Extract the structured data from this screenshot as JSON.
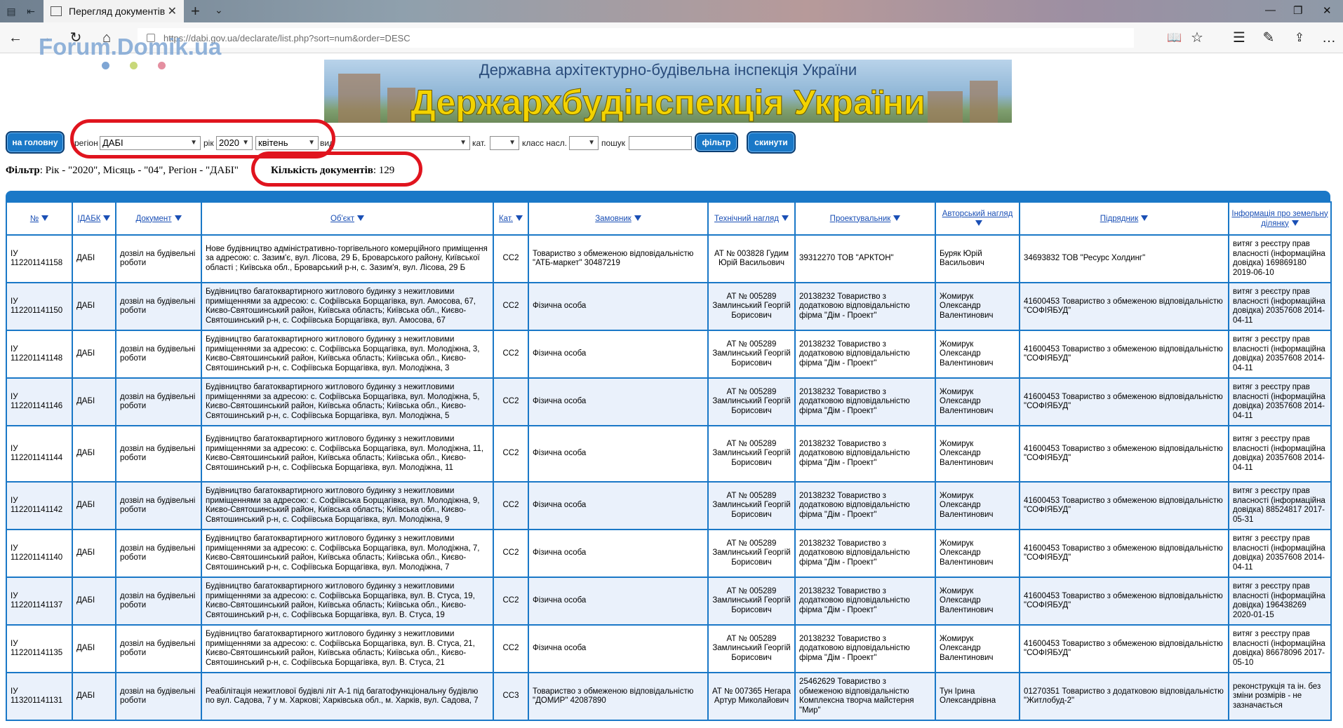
{
  "browser": {
    "tab_title": "Перегляд документів",
    "url": "https://dabi.gov.ua/declarate/list.php?sort=num&order=DESC"
  },
  "watermark": {
    "text": "Forum.Domik.ua",
    "dot_colors": [
      "#7fa6d4",
      "#c8d87a",
      "#e48fa0"
    ]
  },
  "banner": {
    "subtitle": "Державна архітектурно-будівельна інспекція України",
    "title": "Держархбудінспекція України"
  },
  "filters": {
    "home_button": "на головну",
    "region_label": "регіон",
    "region_value": "ДАБІ",
    "year_label": "рік",
    "year_value": "2020",
    "month_value": "квітень",
    "type_label": "вид",
    "type_value": "",
    "cat_label": "кат.",
    "cat_value": "",
    "class_label": "класс насл.",
    "class_value": "",
    "search_label": "пошук",
    "search_value": "",
    "filter_button": "фільтр",
    "reset_button": "скинути"
  },
  "summary": {
    "filter_label": "Фільтр",
    "filter_text": ": Рік - \"2020\", Місяць - \"04\", Регіон - \"ДАБІ\"",
    "count_label": "Кількість документів",
    "count_value": ": 129"
  },
  "table": {
    "headers": [
      "№",
      "ІДАБК",
      "Документ",
      "Об'єкт",
      "Кат.",
      "Замовник",
      "Технічний нагляд",
      "Проектувальник",
      "Авторський нагляд",
      "Підрядник",
      "Інформація про земельну ділянку"
    ],
    "rows": [
      {
        "num": "ІУ 112201141158",
        "idabk": "ДАБІ",
        "doc": "дозвіл на будівельні роботи",
        "object": "Нове будівництво адміністративно-торгівельного комерційного приміщення за адресою: с. Зазим'є, вул. Лісова, 29 Б, Броварського району, Київської області ; Київська обл., Броварський р-н, с. Зазим'я, вул. Лісова, 29 Б",
        "cat": "СС2",
        "customer": "Товариство з обмеженою відповідальністю \"АТБ-маркет\" 30487219",
        "tech": "АТ № 003828 Гудим Юрій Васильович",
        "designer": "39312270 ТОВ \"АРКТОН\"",
        "author": "Буряк Юрій Васильович",
        "contractor": "34693832 ТОВ \"Ресурс Холдинг\"",
        "land": "витяг з реєстру прав власності (інформаційна довідка) 169869180 2019-06-10"
      },
      {
        "num": "ІУ 112201141150",
        "idabk": "ДАБІ",
        "doc": "дозвіл на будівельні роботи",
        "object": "Будівництво багатоквартирного житлового будинку з нежитловими приміщеннями за адресою: с. Софіївська Борщагівка, вул. Амосова, 67, Києво-Святошинський район, Київська область; Київська обл., Києво-Святошинський р-н, с. Софіївська Борщагівка, вул. Амосова, 67",
        "cat": "СС2",
        "customer": "Фізична особа",
        "tech": "АТ № 005289 Замлинський Георгій Борисович",
        "designer": "20138232 Товариство з додатковою відповідальністю фірма \"Дім - Проект\"",
        "author": "Жомирук Олександр Валентинович",
        "contractor": "41600453 Товариство з обмеженою відповідальністю \"СОФІЯБУД\"",
        "land": "витяг з реєстру прав власності (інформаційна довідка) 20357608 2014-04-11"
      },
      {
        "num": "ІУ 112201141148",
        "idabk": "ДАБІ",
        "doc": "дозвіл на будівельні роботи",
        "object": "Будівництво багатоквартирного житлового будинку з нежитловими приміщеннями за адресою: с. Софіївська Борщагівка, вул. Молодіжна, 3, Києво-Святошинський район, Київська область; Київська обл., Києво-Святошинський р-н, с. Софіївська Борщагівка, вул. Молодіжна, 3",
        "cat": "СС2",
        "customer": "Фізична особа",
        "tech": "АТ № 005289 Замлинський Георгій Борисович",
        "designer": "20138232 Товариство з додатковою відповідальністю фірма \"Дім - Проект\"",
        "author": "Жомирук Олександр Валентинович",
        "contractor": "41600453 Товариство з обмеженою відповідальністю \"СОФІЯБУД\"",
        "land": "витяг з реєстру прав власності (інформаційна довідка) 20357608 2014-04-11"
      },
      {
        "num": "ІУ 112201141146",
        "idabk": "ДАБІ",
        "doc": "дозвіл на будівельні роботи",
        "object": "Будівництво багатоквартирного житлового будинку з нежитловими приміщеннями за адресою: с. Софіївська Борщагівка, вул. Молодіжна, 5, Києво-Святошинський район, Київська область; Київська обл., Києво-Святошинський р-н, с. Софіївська Борщагівка, вул. Молодіжна, 5",
        "cat": "СС2",
        "customer": "Фізична особа",
        "tech": "АТ № 005289 Замлинський Георгій Борисович",
        "designer": "20138232 Товариство з додатковою відповідальністю фірма \"Дім - Проект\"",
        "author": "Жомирук Олександр Валентинович",
        "contractor": "41600453 Товариство з обмеженою відповідальністю \"СОФІЯБУД\"",
        "land": "витяг з реєстру прав власності (інформаційна довідка) 20357608 2014-04-11"
      },
      {
        "num": "ІУ 112201141144",
        "idabk": "ДАБІ",
        "doc": "дозвіл на будівельні роботи",
        "object": "Будівництво багатоквартирного житлового будинку з нежитловими приміщеннями за адресою: с. Софіївська Борщагівка, вул. Молодіжна, 11, Києво-Святошинський район, Київська область; Київська обл., Києво-Святошинський р-н, с. Софіївська Борщагівка, вул. Молодіжна, 11",
        "cat": "СС2",
        "customer": "Фізична особа",
        "tech": "АТ № 005289 Замлинський Георгій Борисович",
        "designer": "20138232 Товариство з додатковою відповідальністю фірма \"Дім - Проект\"",
        "author": "Жомирук Олександр Валентинович",
        "contractor": "41600453 Товариство з обмеженою відповідальністю \"СОФІЯБУД\"",
        "land": "витяг з реєстру прав власності (інформаційна довідка) 20357608 2014-04-11"
      },
      {
        "num": "ІУ 112201141142",
        "idabk": "ДАБІ",
        "doc": "дозвіл на будівельні роботи",
        "object": "Будівництво багатоквартирного житлового будинку з нежитловими приміщеннями за адресою: с. Софіївська Борщагівка, вул. Молодіжна, 9, Києво-Святошинський район, Київська область; Київська обл., Києво-Святошинський р-н, с. Софіївська Борщагівка, вул. Молодіжна, 9",
        "cat": "СС2",
        "customer": "Фізична особа",
        "tech": "АТ № 005289 Замлинський Георгій Борисович",
        "designer": "20138232 Товариство з додатковою відповідальністю фірма \"Дім - Проект\"",
        "author": "Жомирук Олександр Валентинович",
        "contractor": "41600453 Товариство з обмеженою відповідальністю \"СОФІЯБУД\"",
        "land": "витяг з реєстру прав власності (інформаційна довідка) 88524817 2017-05-31"
      },
      {
        "num": "ІУ 112201141140",
        "idabk": "ДАБІ",
        "doc": "дозвіл на будівельні роботи",
        "object": "Будівництво багатоквартирного житлового будинку з нежитловими приміщеннями за адресою: с. Софіївська Борщагівка, вул. Молодіжна, 7, Києво-Святошинський район, Київська область; Київська обл., Києво-Святошинський р-н, с. Софіївська Борщагівка, вул. Молодіжна, 7",
        "cat": "СС2",
        "customer": "Фізична особа",
        "tech": "АТ № 005289 Замлинський Георгій Борисович",
        "designer": "20138232 Товариство з додатковою відповідальністю фірма \"Дім - Проект\"",
        "author": "Жомирук Олександр Валентинович",
        "contractor": "41600453 Товариство з обмеженою відповідальністю \"СОФІЯБУД\"",
        "land": "витяг з реєстру прав власності (інформаційна довідка) 20357608 2014-04-11"
      },
      {
        "num": "ІУ 112201141137",
        "idabk": "ДАБІ",
        "doc": "дозвіл на будівельні роботи",
        "object": "Будівництво багатоквартирного житлового будинку з нежитловими приміщеннями за адресою: с. Софіївська Борщагівка, вул. В. Стуса, 19, Києво-Святошинський район, Київська область; Київська обл., Києво-Святошинський р-н, с. Софіївська Борщагівка, вул. В. Стуса, 19",
        "cat": "СС2",
        "customer": "Фізична особа",
        "tech": "АТ № 005289 Замлинський Георгій Борисович",
        "designer": "20138232 Товариство з додатковою відповідальністю фірма \"Дім - Проект\"",
        "author": "Жомирук Олександр Валентинович",
        "contractor": "41600453 Товариство з обмеженою відповідальністю \"СОФІЯБУД\"",
        "land": "витяг з реєстру прав власності (інформаційна довідка) 196438269 2020-01-15"
      },
      {
        "num": "ІУ 112201141135",
        "idabk": "ДАБІ",
        "doc": "дозвіл на будівельні роботи",
        "object": "Будівництво багатоквартирного житлового будинку з нежитловими приміщеннями за адресою: с. Софіївська Борщагівка, вул. В. Стуса, 21, Києво-Святошинський район, Київська область; Київська обл., Києво-Святошинський р-н, с. Софіївська Борщагівка, вул. В. Стуса, 21",
        "cat": "СС2",
        "customer": "Фізична особа",
        "tech": "АТ № 005289 Замлинський Георгій Борисович",
        "designer": "20138232 Товариство з додатковою відповідальністю фірма \"Дім - Проект\"",
        "author": "Жомирук Олександр Валентинович",
        "contractor": "41600453 Товариство з обмеженою відповідальністю \"СОФІЯБУД\"",
        "land": "витяг з реєстру прав власності (інформаційна довідка) 86678096 2017-05-10"
      },
      {
        "num": "ІУ 113201141131",
        "idabk": "ДАБІ",
        "doc": "дозвіл на будівельні роботи",
        "object": "Реабілітація нежитлової будівлі літ А-1 під багатофункціональну будівлю по вул. Садова, 7 у м. Харкові; Харківська обл., м. Харків, вул. Садова, 7",
        "cat": "СС3",
        "customer": "Товариство з обмеженою відповідальністю \"ДОМИР\" 42087890",
        "tech": "АТ № 007365 Негара Артур Миколайович",
        "designer": "25462629 Товариство з обмеженою відповідальністю Комплексна творча майстерня \"Мир\"",
        "author": "Тун Ірина Олександрівна",
        "contractor": "01270351 Товариство з додатковою відповідальністю \"Житлобуд-2\"",
        "land": "реконструкція та ін. без зміни розмірів - не зазначається"
      }
    ]
  }
}
